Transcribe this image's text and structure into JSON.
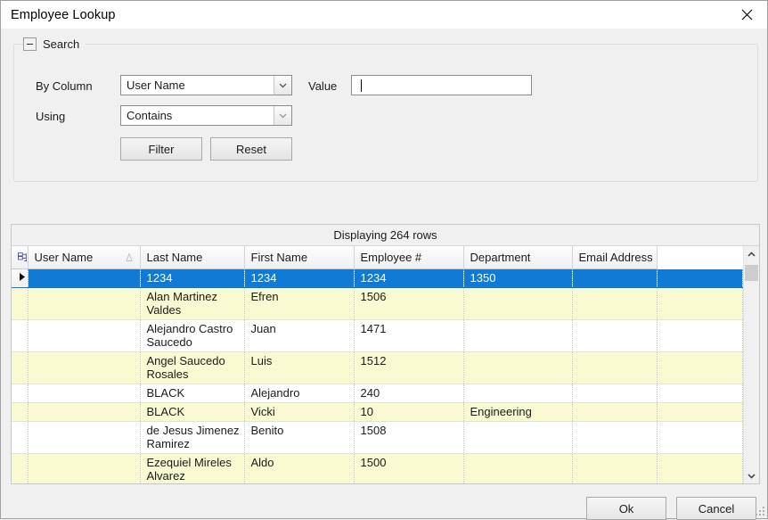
{
  "window": {
    "title": "Employee Lookup",
    "close_icon": "close-icon"
  },
  "search": {
    "group_title": "Search",
    "collapse_icon": "minus-icon",
    "by_column_label": "By Column",
    "by_column_value": "User Name",
    "using_label": "Using",
    "using_value": "Contains",
    "value_label": "Value",
    "value_text": "",
    "value_placeholder": "",
    "filter_button": "Filter",
    "reset_button": "Reset"
  },
  "grid": {
    "status": "Displaying 264 rows",
    "select_all_icon": "select-all-grid-icon",
    "sort_indicator": "sort-ascending-icon",
    "row_marker_icon": "current-row-arrow-icon",
    "columns": [
      "User Name",
      "Last Name",
      "First Name",
      "Employee #",
      "Department",
      "Email Address"
    ],
    "rows": [
      {
        "selected": true,
        "cells": [
          "",
          "1234",
          "1234",
          "1234",
          "1350",
          ""
        ]
      },
      {
        "selected": false,
        "cells": [
          "",
          "Alan Martinez Valdes",
          "Efren",
          "1506",
          "",
          ""
        ]
      },
      {
        "selected": false,
        "cells": [
          "",
          "Alejandro Castro Saucedo",
          "Juan",
          "1471",
          "",
          ""
        ]
      },
      {
        "selected": false,
        "cells": [
          "",
          "Angel Saucedo Rosales",
          "Luis",
          "1512",
          "",
          ""
        ]
      },
      {
        "selected": false,
        "cells": [
          "",
          "BLACK",
          "Alejandro",
          "240",
          "",
          ""
        ]
      },
      {
        "selected": false,
        "cells": [
          "",
          "BLACK",
          "Vicki",
          "10",
          "Engineering",
          ""
        ]
      },
      {
        "selected": false,
        "cells": [
          "",
          "de Jesus Jimenez Ramirez",
          "Benito",
          "1508",
          "",
          ""
        ]
      },
      {
        "selected": false,
        "cells": [
          "",
          "Ezequiel Mireles Alvarez",
          "Aldo",
          "1500",
          "",
          ""
        ]
      }
    ],
    "scrollbar": {
      "up_icon": "chevron-up-icon",
      "down_icon": "chevron-down-icon"
    }
  },
  "footer": {
    "ok_button": "Ok",
    "cancel_button": "Cancel",
    "resize_grip_icon": "resize-grip-icon"
  },
  "colors": {
    "selection": "#0f7bd4",
    "alt_row": "#fafad2",
    "window_bg": "#f0f0f0",
    "border": "#c3c9cf"
  }
}
